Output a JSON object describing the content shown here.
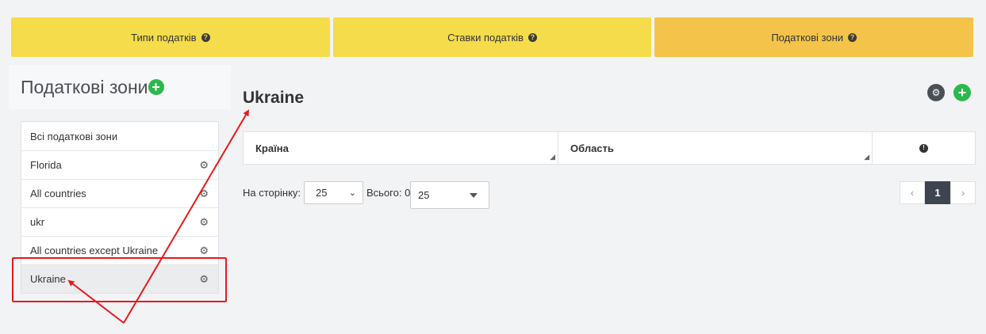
{
  "colors": {
    "tab_yellow": "#f5dc4a",
    "tab_active": "#f3c449",
    "accent_green": "#2db84c",
    "annotation_red": "#e8191c",
    "pager_active": "#3f4550"
  },
  "tabs": [
    {
      "label": "Типи податків",
      "active": false
    },
    {
      "label": "Ставки податків",
      "active": false
    },
    {
      "label": "Податкові зони",
      "active": true
    }
  ],
  "sidebar": {
    "title": "Податкові зони",
    "items": [
      {
        "label": "Всі податкові зони",
        "has_gear": false
      },
      {
        "label": "Florida",
        "has_gear": true
      },
      {
        "label": "All countries",
        "has_gear": true
      },
      {
        "label": "ukr",
        "has_gear": true
      },
      {
        "label": "All countries except Ukraine",
        "has_gear": true
      },
      {
        "label": "Ukraine",
        "has_gear": true,
        "active": true
      }
    ]
  },
  "main": {
    "title": "Ukraine",
    "table": {
      "columns": [
        "Країна",
        "Область"
      ]
    },
    "pager": {
      "per_page_label": "На сторінку:",
      "per_page_value": "25",
      "total_label": "Всього: 0",
      "total_select_value": "25",
      "current_page": "1"
    }
  }
}
